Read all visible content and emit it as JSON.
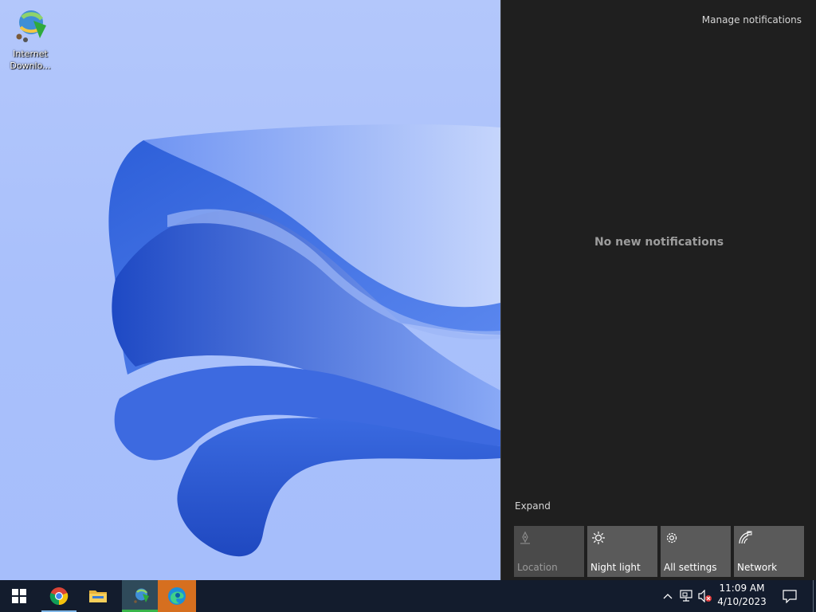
{
  "desktop": {
    "icons": [
      {
        "label": "Internet\nDownlo...",
        "icon": "idm-icon"
      }
    ]
  },
  "action_center": {
    "manage_label": "Manage notifications",
    "empty_label": "No new notifications",
    "expand_label": "Expand",
    "tiles": [
      {
        "label": "Location",
        "icon": "location-icon",
        "enabled": false
      },
      {
        "label": "Night light",
        "icon": "night-light-icon",
        "enabled": true
      },
      {
        "label": "All settings",
        "icon": "gear-icon",
        "enabled": true
      },
      {
        "label": "Network",
        "icon": "network-icon",
        "enabled": true
      }
    ]
  },
  "taskbar": {
    "apps": [
      {
        "name": "Start",
        "icon": "windows-start-icon"
      },
      {
        "name": "Google Chrome",
        "icon": "chrome-icon"
      },
      {
        "name": "File Explorer",
        "icon": "folder-icon"
      },
      {
        "name": "Internet Download Manager",
        "icon": "idm-icon"
      },
      {
        "name": "Microsoft Edge",
        "icon": "edge-icon"
      }
    ],
    "tray": {
      "time": "11:09 AM",
      "date": "4/10/2023"
    }
  },
  "colors": {
    "action_center_bg": "#1f1f1f",
    "tile_bg": "#5a5a5a",
    "taskbar_bg": "#131c2d",
    "wallpaper_bg": "#aec4fa"
  }
}
